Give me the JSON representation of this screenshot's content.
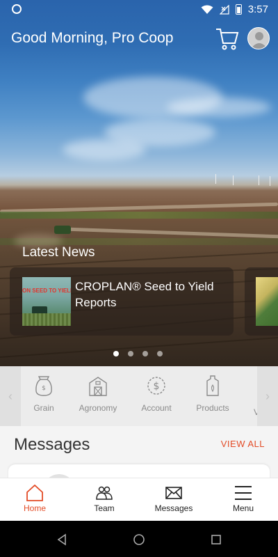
{
  "status_bar": {
    "time": "3:57",
    "icons": [
      "app-notification-icon",
      "wifi-icon",
      "no-signal-icon",
      "battery-icon"
    ]
  },
  "header": {
    "greeting": "Good Morning, Pro Coop",
    "icons": [
      "cart-icon",
      "profile-avatar-icon"
    ]
  },
  "news": {
    "section_title": "Latest News",
    "items": [
      {
        "title": "CROPLAN® Seed to Yield Reports",
        "thumb_text": "ON SEED TO YIELD"
      }
    ],
    "pagination": {
      "count": 4,
      "active_index": 0
    }
  },
  "categories": {
    "items": [
      {
        "label": "Grain",
        "icon": "grain-bag-icon"
      },
      {
        "label": "Agronomy",
        "icon": "barn-icon"
      },
      {
        "label": "Account",
        "icon": "dollar-coin-icon"
      },
      {
        "label": "Products",
        "icon": "product-jug-icon"
      },
      {
        "label": "V",
        "icon": "partial-item"
      }
    ]
  },
  "messages": {
    "title": "Messages",
    "view_all": "VIEW ALL"
  },
  "bottom_nav": {
    "items": [
      {
        "label": "Home",
        "icon": "home-icon",
        "active": true
      },
      {
        "label": "Team",
        "icon": "team-icon",
        "active": false
      },
      {
        "label": "Messages",
        "icon": "envelope-icon",
        "active": false
      },
      {
        "label": "Menu",
        "icon": "hamburger-menu-icon",
        "active": false
      }
    ]
  },
  "colors": {
    "accent": "#e34b26",
    "header_blue": "#2a64ac",
    "category_bg": "#ececec",
    "category_label": "#8a8a8a"
  }
}
